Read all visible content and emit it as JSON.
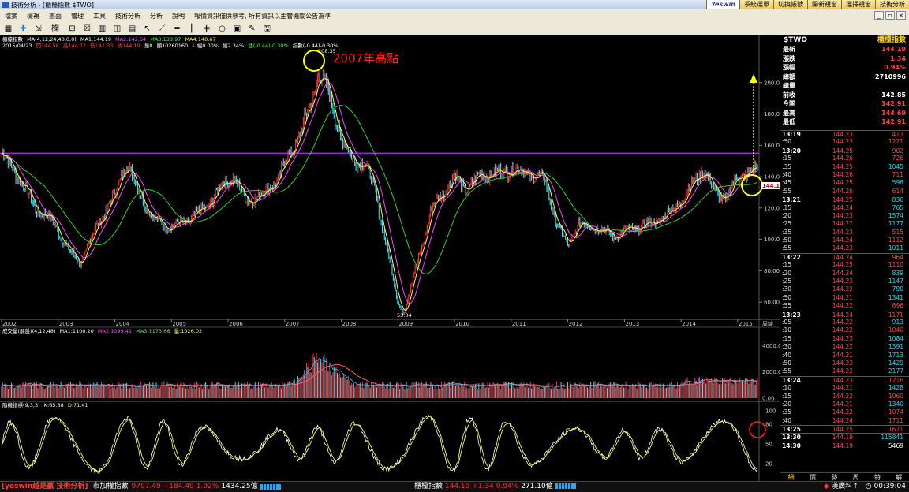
{
  "window": {
    "title": "技術分析 - [櫃檯指數 $TWO]"
  },
  "topnav": {
    "logo": "Yeswin",
    "buttons": [
      "系統選單",
      "切換帳號",
      "開新視窗",
      "選擇視窗",
      "技術分析"
    ]
  },
  "menu": {
    "items": [
      "檔案",
      "檢視",
      "畫面",
      "管理",
      "工具",
      "技術分析",
      "分析",
      "說明"
    ],
    "notice": "報價資訊僅供參考, 所有資訊以主管機關公告為準"
  },
  "toolbar": {
    "period": "欄"
  },
  "price_info": {
    "name": "櫃檯指數",
    "ma_params": "MA(4,12,24,48,0,0)",
    "ma1": "MA1:144.19",
    "ma2": "MA2:142.64",
    "ma3": "MA3:138.97",
    "ma4": "MA4:140.67",
    "date": "2015/04/23",
    "open": "開144.58",
    "high": "高144.72",
    "low": "低141.33",
    "close": "收144.19",
    "vol": "量0",
    "amount": "額10260160",
    "chg1": "↓ 幅0.00%",
    "chg2": "幅2.34%",
    "osc": "漲(-0.44)-0.30%",
    "idx": "指數(-0.44)-0.30%"
  },
  "volume_info": {
    "name": "成交量(解盤)(4,12,48)",
    "ma1": "MA1:1100.20",
    "ma2": "MA2:1099.41",
    "ma3": "MA3:1173.66",
    "vol": "量:1026.02"
  },
  "kd_info": {
    "name": "隨機指標(9,3,3)",
    "k": "K:65.38",
    "d": "D:71.41"
  },
  "annotation": {
    "label": "2007年高點",
    "peak_label": "208.35",
    "low_label": "53.04",
    "last_label": "144.19"
  },
  "chart_data": [
    {
      "type": "line",
      "title": "櫃檯指數",
      "x": [
        "2002",
        "2003",
        "2004",
        "2005",
        "2006",
        "2007",
        "2008",
        "2009",
        "2010",
        "2011",
        "2012",
        "2013",
        "2014",
        "2015"
      ],
      "xlabel": "周線",
      "ylim": [
        50,
        220
      ],
      "yticks": [
        60,
        80,
        100,
        120,
        140,
        160,
        180,
        200
      ],
      "series": [
        {
          "name": "Close",
          "points": [
            [
              2002.0,
              155
            ],
            [
              2002.3,
              140
            ],
            [
              2002.6,
              120
            ],
            [
              2002.9,
              112
            ],
            [
              2003.2,
              92
            ],
            [
              2003.4,
              85
            ],
            [
              2003.7,
              110
            ],
            [
              2004.0,
              128
            ],
            [
              2004.2,
              150
            ],
            [
              2004.4,
              132
            ],
            [
              2004.7,
              112
            ],
            [
              2005.0,
              108
            ],
            [
              2005.3,
              112
            ],
            [
              2005.6,
              120
            ],
            [
              2005.9,
              135
            ],
            [
              2006.1,
              140
            ],
            [
              2006.3,
              125
            ],
            [
              2006.6,
              128
            ],
            [
              2006.9,
              140
            ],
            [
              2007.1,
              155
            ],
            [
              2007.3,
              170
            ],
            [
              2007.5,
              190
            ],
            [
              2007.6,
              208
            ],
            [
              2007.8,
              190
            ],
            [
              2008.0,
              165
            ],
            [
              2008.2,
              150
            ],
            [
              2008.4,
              150
            ],
            [
              2008.6,
              130
            ],
            [
              2008.8,
              95
            ],
            [
              2009.0,
              60
            ],
            [
              2009.1,
              53
            ],
            [
              2009.3,
              80
            ],
            [
              2009.6,
              120
            ],
            [
              2009.8,
              130
            ],
            [
              2010.0,
              140
            ],
            [
              2010.2,
              132
            ],
            [
              2010.5,
              142
            ],
            [
              2010.8,
              142
            ],
            [
              2011.0,
              145
            ],
            [
              2011.3,
              142
            ],
            [
              2011.6,
              138
            ],
            [
              2011.8,
              110
            ],
            [
              2012.0,
              96
            ],
            [
              2012.2,
              110
            ],
            [
              2012.5,
              108
            ],
            [
              2012.8,
              102
            ],
            [
              2013.0,
              105
            ],
            [
              2013.3,
              108
            ],
            [
              2013.6,
              112
            ],
            [
              2013.9,
              120
            ],
            [
              2014.2,
              135
            ],
            [
              2014.4,
              145
            ],
            [
              2014.6,
              130
            ],
            [
              2014.8,
              126
            ],
            [
              2015.0,
              140
            ],
            [
              2015.3,
              144.19
            ]
          ]
        }
      ],
      "annotations": [
        "2007年高點",
        "208.35",
        "53.04",
        "144.19"
      ],
      "reference_line": 155
    },
    {
      "type": "bar",
      "title": "成交量(解盤)(4,12,48)",
      "ylim": [
        0,
        4500
      ],
      "yticks": [
        0,
        2000,
        4000
      ]
    },
    {
      "type": "line",
      "title": "隨機指標(9,3,3)",
      "ylim": [
        0,
        100
      ],
      "yticks": [
        20,
        50,
        80,
        100
      ]
    }
  ],
  "quote": {
    "symbol": "$TWO",
    "name": "櫃檯指數",
    "rows": [
      {
        "label": "最新",
        "value": "144.19",
        "color": "#ff4040"
      },
      {
        "label": "漲跌",
        "value": "1.34",
        "color": "#ff4040"
      },
      {
        "label": "漲幅",
        "value": "0.94%",
        "color": "#ff4040"
      },
      {
        "label": "總額",
        "value": "2710996",
        "color": "#ffffff"
      },
      {
        "label": "總量",
        "value": "",
        "color": "#ffffff"
      },
      {
        "label": "前收",
        "value": "142.85",
        "color": "#ffffff"
      },
      {
        "label": "今開",
        "value": "142.91",
        "color": "#ff4040"
      },
      {
        "label": "最高",
        "value": "144.69",
        "color": "#ff4040"
      },
      {
        "label": "最低",
        "value": "142.91",
        "color": "#ff4040"
      }
    ]
  },
  "ticks": [
    {
      "t": "13:19",
      "b": true,
      "p": "144.23",
      "v": "413",
      "c": "#ff4040"
    },
    {
      "t": ":50",
      "p": "144.23",
      "v": "1221",
      "c": "#ff4040"
    },
    {
      "t": "13:20",
      "b": true,
      "p": "144.25",
      "v": "902",
      "c": "#ff4040"
    },
    {
      "t": ":15",
      "p": "144.26",
      "v": "726",
      "c": "#ff4040"
    },
    {
      "t": ":35",
      "p": "144.25",
      "v": "1045",
      "c": "#00e0ff"
    },
    {
      "t": ":40",
      "p": "144.26",
      "v": "711",
      "c": "#ff4040"
    },
    {
      "t": ":45",
      "p": "144.25",
      "v": "598",
      "c": "#00e0ff"
    },
    {
      "t": ":55",
      "p": "144.26",
      "v": "614",
      "c": "#ff4040"
    },
    {
      "t": "13:21",
      "b": true,
      "p": "144.25",
      "v": "836",
      "c": "#00e0ff"
    },
    {
      "t": ":15",
      "p": "144.24",
      "v": "765",
      "c": "#00e0ff"
    },
    {
      "t": ":20",
      "p": "144.23",
      "v": "1574",
      "c": "#00e0ff"
    },
    {
      "t": ":25",
      "p": "144.22",
      "v": "1177",
      "c": "#00e0ff"
    },
    {
      "t": ":35",
      "p": "144.23",
      "v": "515",
      "c": "#ff4040"
    },
    {
      "t": ":50",
      "p": "144.24",
      "v": "1112",
      "c": "#ff4040"
    },
    {
      "t": ":55",
      "p": "144.23",
      "v": "1011",
      "c": "#00e0ff"
    },
    {
      "t": "13:22",
      "b": true,
      "p": "144.24",
      "v": "964",
      "c": "#ff4040"
    },
    {
      "t": ":15",
      "p": "144.25",
      "v": "1110",
      "c": "#ff4040"
    },
    {
      "t": ":20",
      "p": "144.24",
      "v": "839",
      "c": "#00e0ff"
    },
    {
      "t": ":25",
      "p": "144.23",
      "v": "1147",
      "c": "#00e0ff"
    },
    {
      "t": ":30",
      "p": "144.22",
      "v": "790",
      "c": "#00e0ff"
    },
    {
      "t": ":50",
      "p": "144.21",
      "v": "1341",
      "c": "#00e0ff"
    },
    {
      "t": ":55",
      "p": "144.22",
      "v": "896",
      "c": "#ff4040"
    },
    {
      "t": "13:23",
      "b": true,
      "p": "144.24",
      "v": "1171",
      "c": "#ff4040"
    },
    {
      "t": ":05",
      "p": "144.22",
      "v": "913",
      "c": "#00e0ff"
    },
    {
      "t": ":10",
      "p": "144.22",
      "v": "1040",
      "c": "#ff4040"
    },
    {
      "t": ":15",
      "p": "144.23",
      "v": "1084",
      "c": "#00e0ff"
    },
    {
      "t": ":30",
      "p": "144.22",
      "v": "1391",
      "c": "#00e0ff"
    },
    {
      "t": ":40",
      "p": "144.21",
      "v": "1713",
      "c": "#00e0ff"
    },
    {
      "t": ":50",
      "p": "144.23",
      "v": "1429",
      "c": "#00e0ff"
    },
    {
      "t": ":55",
      "p": "144.22",
      "v": "2177",
      "c": "#00e0ff"
    },
    {
      "t": "13:24",
      "b": true,
      "p": "144.23",
      "v": "1216",
      "c": "#ff4040"
    },
    {
      "t": ":10",
      "p": "144.21",
      "v": "1428",
      "c": "#00e0ff"
    },
    {
      "t": ":15",
      "p": "144.22",
      "v": "1060",
      "c": "#ff4040"
    },
    {
      "t": ":20",
      "p": "144.21",
      "v": "1340",
      "c": "#00e0ff"
    },
    {
      "t": ":35",
      "p": "144.22",
      "v": "1074",
      "c": "#ff4040"
    },
    {
      "t": ":40",
      "p": "144.24",
      "v": "1711",
      "c": "#ff4040"
    },
    {
      "t": "13:25",
      "b": true,
      "p": "144.25",
      "v": "1621",
      "c": "#ff4040"
    },
    {
      "t": "13:30",
      "b": true,
      "p": "144.19",
      "v": "115841",
      "c": "#00e0ff"
    },
    {
      "t": "14:30",
      "b": true,
      "p": "144.19",
      "v": "5469",
      "c": "#ffffff"
    }
  ],
  "tabs": [
    "細",
    "價",
    "勢",
    "周",
    "特",
    "解"
  ],
  "status": {
    "brand": "[yeswin越是贏 技術分析]",
    "market_name": "市加權指數",
    "market_val": "9797.49",
    "market_chg": "+184.49",
    "market_pct": "1.92%",
    "market_amt": "1434.25億",
    "otc_name": "櫃檯指數",
    "otc_val": "144.19",
    "otc_chg": "+1.34",
    "otc_pct": "0.94%",
    "otc_amt": "271.10億",
    "info": "漢廣料↑",
    "clock": "00:39:04"
  }
}
